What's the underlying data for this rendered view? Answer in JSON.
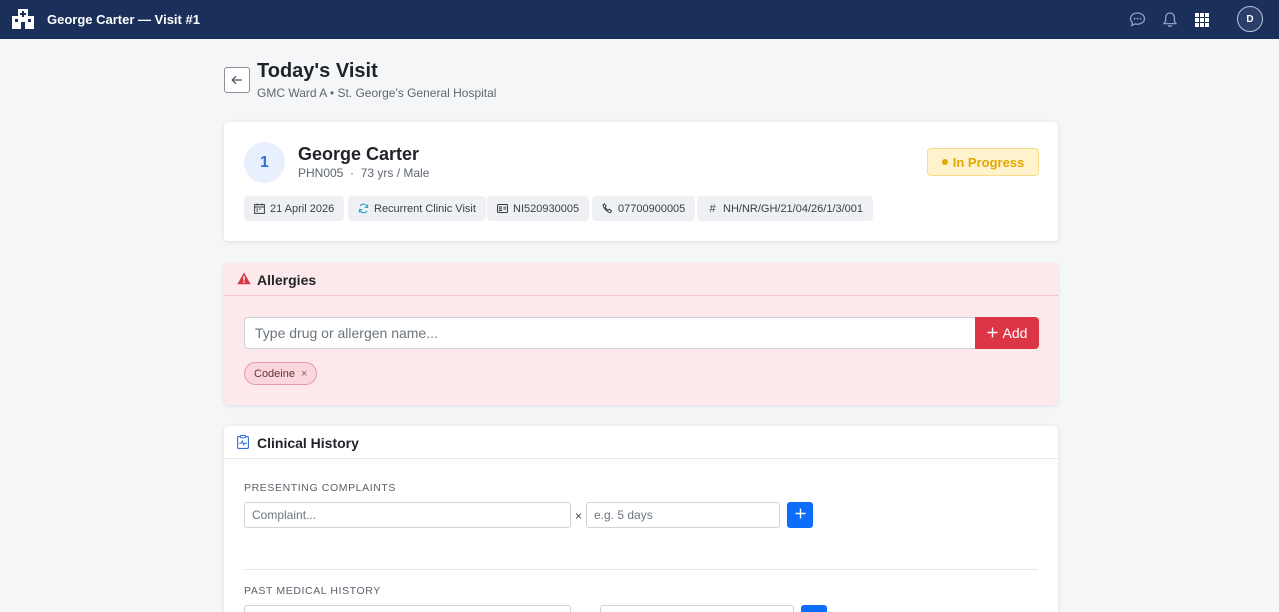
{
  "app": {
    "title": "George Carter — Visit #1",
    "avatar_initial": "D"
  },
  "header": {
    "title": "Today's Visit",
    "subtitle": "GMC Ward A • St. George's General Hospital"
  },
  "patient": {
    "number": "1",
    "name": "George Carter",
    "meta": "PHN005  ·  73 yrs / Male",
    "status": "In Progress",
    "chips": {
      "date": "21 April 2026",
      "visit_type": "Recurrent Clinic Visit",
      "nic": "NI520930005",
      "phone": "07700900005",
      "reference": "NH/NR/GH/21/04/26/1/3/001"
    }
  },
  "allergies": {
    "title": "Allergies",
    "placeholder": "Type drug or allergen name...",
    "add_label": "Add",
    "items": [
      "Codeine"
    ],
    "remove_symbol": "×"
  },
  "clinical_history": {
    "title": "Clinical History",
    "presenting_label": "Presenting Complaints",
    "complaint_placeholder": "Complaint...",
    "duration_placeholder": "e.g. 5 days",
    "times_symbol": "×",
    "past_label": "Past Medical History"
  },
  "colors": {
    "topbar": "#1b2f5b",
    "danger": "#dc3545",
    "primary": "#0d6efd",
    "warning": "#e0a800"
  }
}
